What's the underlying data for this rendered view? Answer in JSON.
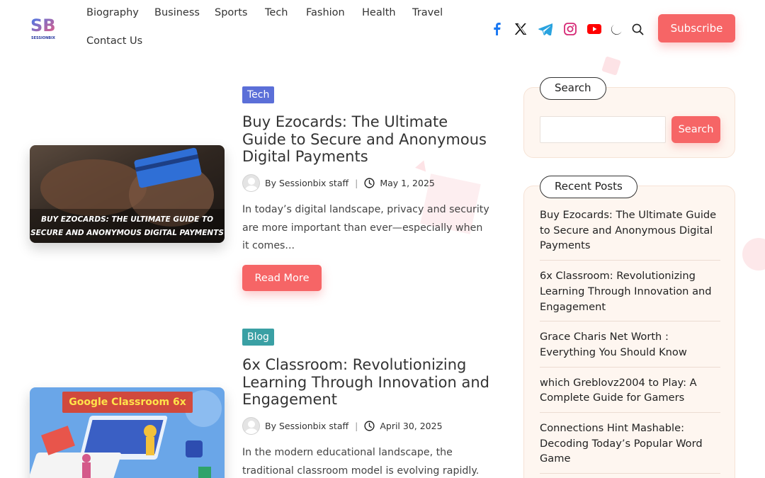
{
  "brand": {
    "logo_text": "SESSIONBIX",
    "logo_letters": "SB"
  },
  "nav": {
    "items": [
      {
        "label": "Biography"
      },
      {
        "label": "Business"
      },
      {
        "label": "Sports"
      },
      {
        "label": "Tech"
      },
      {
        "label": "Fashion"
      },
      {
        "label": "Health"
      },
      {
        "label": "Travel"
      },
      {
        "label": "Contact Us"
      }
    ]
  },
  "social": [
    {
      "name": "facebook-icon",
      "color": "#1877f2"
    },
    {
      "name": "x-icon",
      "color": "#111111"
    },
    {
      "name": "telegram-icon",
      "color": "#2aa3df"
    },
    {
      "name": "instagram-icon",
      "color": "#d62976"
    },
    {
      "name": "youtube-icon",
      "color": "#ff0000"
    }
  ],
  "header": {
    "subscribe_label": "Subscribe"
  },
  "colors": {
    "accent": "#f66566",
    "tech_badge": "#5b6fd8",
    "blog_badge": "#3aa0a4",
    "widget_bg": "#fef6f0"
  },
  "posts": [
    {
      "category": "Tech",
      "title": "Buy Ezocards: The Ultimate Guide to Secure and Anonymous Digital Payments",
      "author": "By Sessionbix staff",
      "date": "May 1, 2025",
      "excerpt": "In today’s digital landscape, privacy and security are more important than ever—especially when it comes...",
      "read_more": "Read More",
      "image_caption_1": "BUY EZOCARDS: THE ULTIMATE GUIDE TO",
      "image_caption_2": "SECURE AND ANONYMOUS DIGITAL PAYMENTS"
    },
    {
      "category": "Blog",
      "title": "6x Classroom: Revolutionizing Learning Through Innovation and Engagement",
      "author": "By Sessionbix staff",
      "date": "April 30, 2025",
      "excerpt": "In the modern educational landscape, the traditional classroom model is evolving rapidly.",
      "image_caption": "Google Classroom 6x"
    }
  ],
  "sidebar": {
    "search": {
      "title": "Search",
      "button": "Search",
      "value": ""
    },
    "recent": {
      "title": "Recent Posts",
      "items": [
        "Buy Ezocards: The Ultimate Guide to Secure and Anonymous Digital Payments",
        "6x Classroom: Revolutionizing Learning Through Innovation and Engagement",
        "Grace Charis Net Worth : Everything You Should Know",
        "which Greblovz2004 to Play: A Complete Guide for Gamers",
        "Connections Hint Mashable: Decoding Today’s Popular Word Game"
      ]
    }
  }
}
